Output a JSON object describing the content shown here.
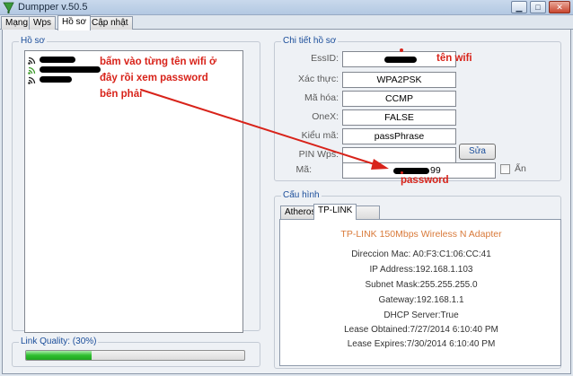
{
  "window": {
    "title": "Dumpper v.50.5"
  },
  "tabs": [
    {
      "label": "Mạng"
    },
    {
      "label": "Wps"
    },
    {
      "label": "Hồ sơ",
      "active": true
    },
    {
      "label": "Cập nhật"
    }
  ],
  "profiles": {
    "title": "Hồ sơ",
    "items": [
      {
        "name": "",
        "icon": "wifi-signal-icon"
      },
      {
        "name": "",
        "icon": "wifi-signal-icon"
      },
      {
        "name": "",
        "icon": "wifi-signal-icon"
      }
    ]
  },
  "annotations": {
    "list_hint_line1": "bấm vào từng tên wifi ở",
    "list_hint_line2": "đây rồi xem password",
    "list_hint_line3": "bên phải",
    "wifi_name_label": "tên wifi",
    "password_label": "password",
    "color": "#d8231a"
  },
  "details": {
    "title": "Chi tiết hồ sơ",
    "fields": [
      {
        "label": "EssID:",
        "value": ""
      },
      {
        "label": "Xác thực:",
        "value": "WPA2PSK"
      },
      {
        "label": "Mã hóa:",
        "value": "CCMP"
      },
      {
        "label": "OneX:",
        "value": "FALSE"
      },
      {
        "label": "Kiểu mã:",
        "value": "passPhrase"
      },
      {
        "label": "PIN Wps:",
        "value": ""
      }
    ],
    "pin_button": "Sửa",
    "key_label": "Mã:",
    "key_value_visible": "99",
    "show_label": "Ẩn"
  },
  "config": {
    "title": "Cấu hình",
    "tabs": [
      {
        "label": "Atheros"
      },
      {
        "label": "TP-LINK",
        "active": true
      }
    ],
    "adapter_title": "TP-LINK 150Mbps Wireless N Adapter",
    "lines": [
      "Direccion Mac: A0:F3:C1:06:CC:41",
      "IP Address:192.168.1.103",
      "Subnet Mask:255.255.255.0",
      "Gateway:192.168.1.1",
      "DHCP Server:True",
      "Lease Obtained:7/27/2014 6:10:40 PM",
      "Lease Expires:7/30/2014 6:10:40 PM"
    ]
  },
  "link_quality": {
    "title": "Link Quality: (30%)",
    "percent": 30
  }
}
